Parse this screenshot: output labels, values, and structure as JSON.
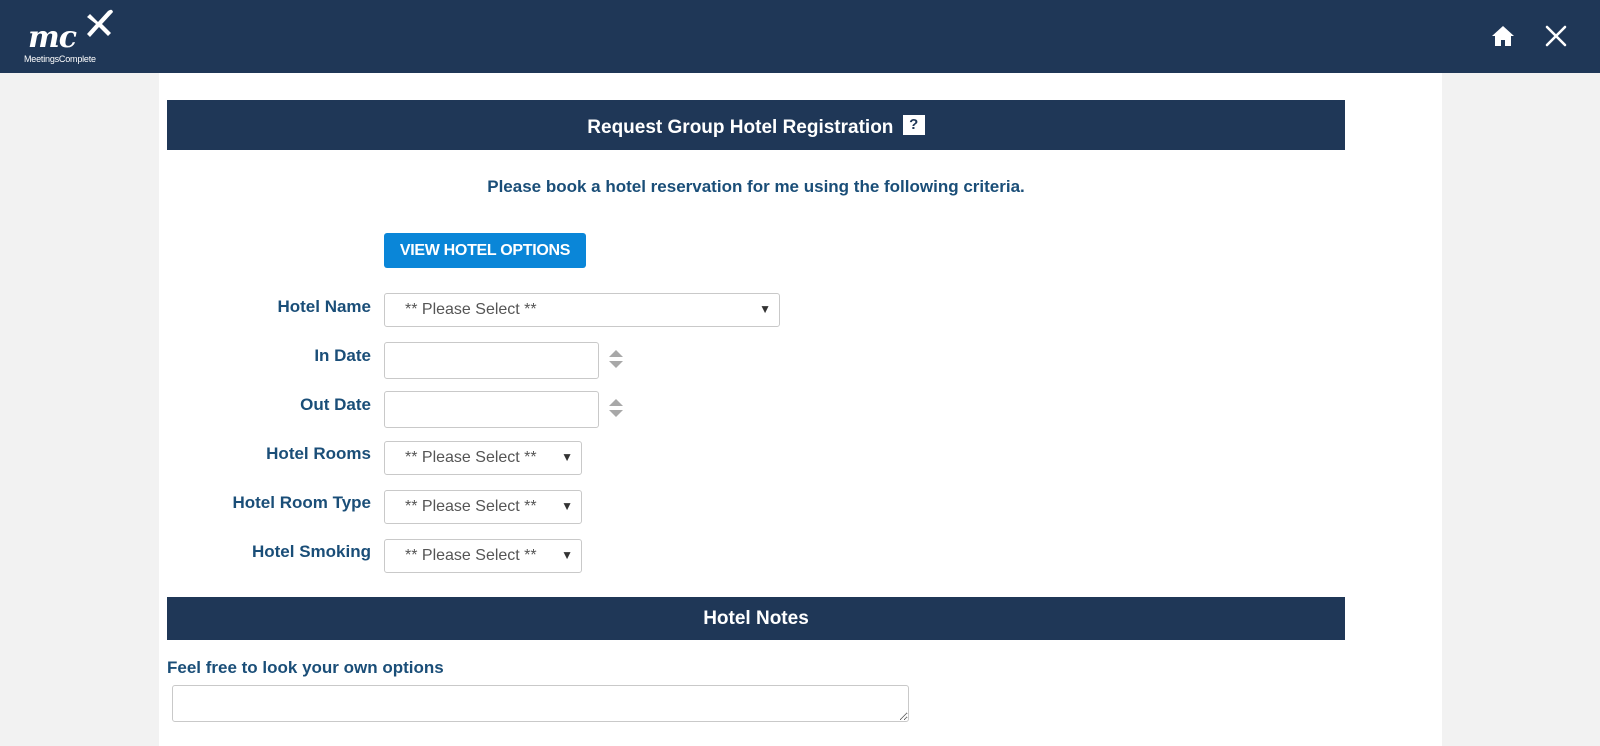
{
  "logo": {
    "text": "mc",
    "subtext": "MeetingsComplete"
  },
  "header_icons": {
    "home": "home-icon",
    "close": "close-icon"
  },
  "section": {
    "title": "Request Group Hotel Registration",
    "help_label": "?",
    "intro": "Please book a hotel reservation for me using the following criteria.",
    "view_button_label": "VIEW HOTEL OPTIONS"
  },
  "form": {
    "hotel_name": {
      "label": "Hotel Name",
      "value": "** Please Select **"
    },
    "in_date": {
      "label": "In Date",
      "value": ""
    },
    "out_date": {
      "label": "Out Date",
      "value": ""
    },
    "hotel_rooms": {
      "label": "Hotel Rooms",
      "value": "** Please Select **"
    },
    "hotel_room_type": {
      "label": "Hotel Room Type",
      "value": "** Please Select **"
    },
    "hotel_smoking": {
      "label": "Hotel Smoking",
      "value": "** Please Select **"
    }
  },
  "notes": {
    "title": "Hotel Notes",
    "label": "Feel free to look your own options",
    "value": ""
  },
  "colors": {
    "header_bg": "#1f3757",
    "label_text": "#1a4e78",
    "button_bg": "#0a86d8"
  }
}
